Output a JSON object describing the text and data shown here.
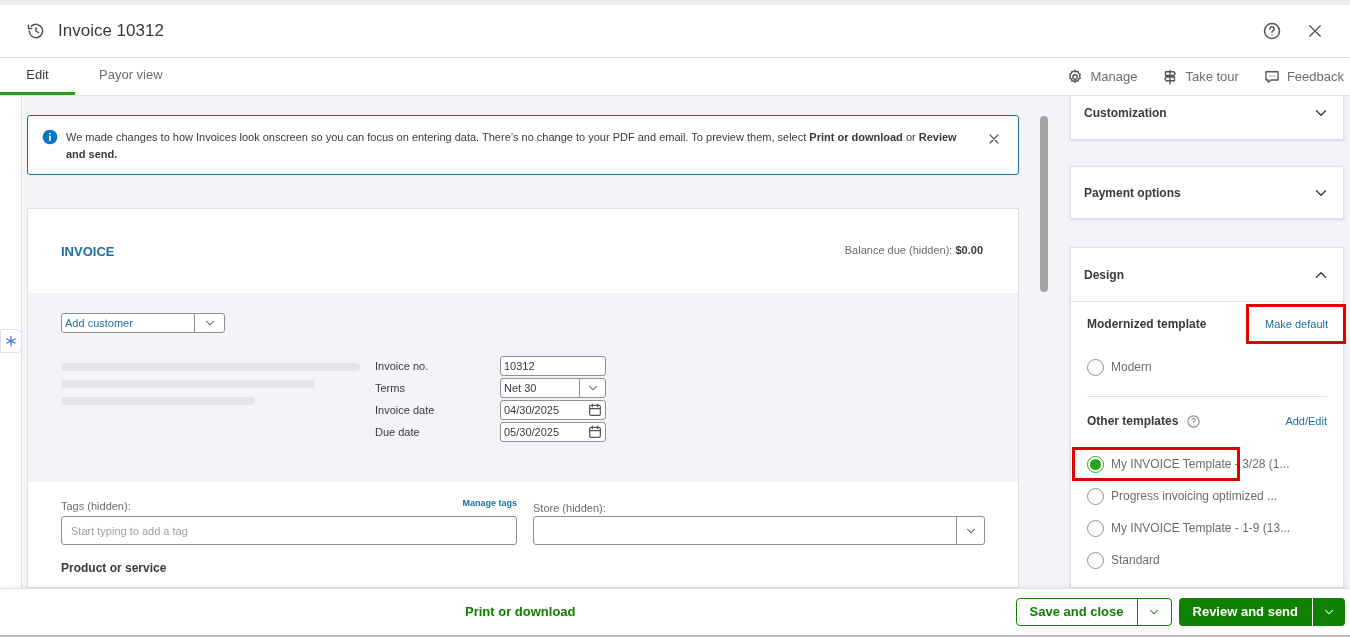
{
  "header": {
    "title": "Invoice 10312"
  },
  "tabs": [
    {
      "label": "Edit",
      "selected": true
    },
    {
      "label": "Payor view",
      "selected": false
    }
  ],
  "toolbar": [
    {
      "label": "Manage",
      "kind": "gear"
    },
    {
      "label": "Take tour",
      "kind": "signpost"
    },
    {
      "label": "Feedback",
      "kind": "chat"
    }
  ],
  "banner": {
    "text": "We made changes to how Invoices look onscreen so you can focus on entering data. There’s no change to your PDF and email. To preview them, select **Print or download** or **Review and send.**"
  },
  "invoice": {
    "heading": "INVOICE",
    "balance": "Balance due (hidden): **$0.00**",
    "customer_placeholder": "Add customer",
    "fields": [
      {
        "label": "Invoice no.",
        "value": "10312",
        "kind": "text"
      },
      {
        "label": "Terms",
        "value": "Net 30",
        "kind": "select"
      },
      {
        "label": "Invoice date",
        "value": "04/30/2025",
        "kind": "date"
      },
      {
        "label": "Due date",
        "value": "05/30/2025",
        "kind": "date"
      }
    ],
    "tags_label": "Tags (hidden):",
    "manage_tags": "Manage tags",
    "tags_placeholder": "Start typing to add a tag",
    "store_label": "Store (hidden):",
    "product_label": "Product or service"
  },
  "sections": [
    {
      "title": "Customization",
      "expanded": false
    },
    {
      "title": "Payment options",
      "expanded": false
    },
    {
      "title": "Design",
      "expanded": true
    }
  ],
  "design": {
    "modernized_label": "Modernized template",
    "make_default": "Make default",
    "make_default_highlighted": true,
    "modernized": [
      {
        "label": "Modern",
        "selected": false,
        "highlighted": false
      }
    ],
    "other_label": "Other templates",
    "add_edit": "Add/Edit",
    "other": [
      {
        "label": "My INVOICE Template - 3/28 (1...",
        "selected": true,
        "highlighted": true
      },
      {
        "label": "Progress invoicing optimized ...",
        "selected": false,
        "highlighted": false
      },
      {
        "label": "My INVOICE Template - 1-9 (13...",
        "selected": false,
        "highlighted": false
      },
      {
        "label": "Standard",
        "selected": false,
        "highlighted": false
      }
    ]
  },
  "footer": {
    "print": "Print or download",
    "save": "Save and close",
    "review": "Review and send"
  }
}
